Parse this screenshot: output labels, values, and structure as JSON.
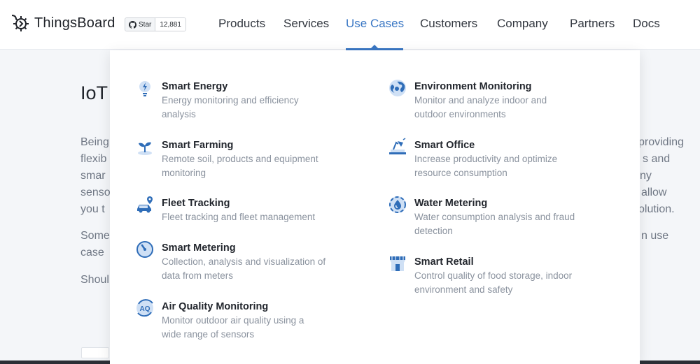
{
  "brand": {
    "name": "ThingsBoard"
  },
  "github": {
    "star_label": "Star",
    "count": "12,881"
  },
  "nav": [
    {
      "label": "Products",
      "name": "nav-products",
      "active": false
    },
    {
      "label": "Services",
      "name": "nav-services",
      "active": false
    },
    {
      "label": "Use Cases",
      "name": "nav-use-cases",
      "active": true
    },
    {
      "label": "Customers",
      "name": "nav-customers",
      "active": false
    },
    {
      "label": "Company",
      "name": "nav-company",
      "active": false
    },
    {
      "label": "Partners",
      "name": "nav-partners",
      "active": false
    },
    {
      "label": "Docs",
      "name": "nav-docs",
      "active": false
    }
  ],
  "background": {
    "title": "IoT",
    "left_lines": [
      "Being",
      "flexib",
      "smar",
      "senso",
      "you t",
      "Some",
      "case",
      "Shoul"
    ],
    "right_lines": [
      "providing",
      "s and",
      "ny",
      "allow",
      "olution.",
      "n use"
    ]
  },
  "menu": {
    "left": [
      {
        "title": "Smart Energy",
        "desc": [
          "Energy monitoring and efficiency",
          "analysis"
        ],
        "icon": "smart-energy-icon"
      },
      {
        "title": "Smart Farming",
        "desc": [
          "Remote soil, products and equipment",
          "monitoring"
        ],
        "icon": "smart-farming-icon"
      },
      {
        "title": "Fleet Tracking",
        "desc": [
          "Fleet tracking and fleet management"
        ],
        "icon": "fleet-tracking-icon"
      },
      {
        "title": "Smart Metering",
        "desc": [
          "Collection, analysis and visualization of",
          "data from meters"
        ],
        "icon": "smart-metering-icon"
      },
      {
        "title": "Air Quality Monitoring",
        "desc": [
          "Monitor outdoor air quality using a",
          "wide range of sensors"
        ],
        "icon": "air-quality-icon"
      }
    ],
    "right": [
      {
        "title": "Environment Monitoring",
        "desc": [
          "Monitor and analyze indoor and",
          "outdoor environments"
        ],
        "icon": "environment-monitoring-icon"
      },
      {
        "title": "Smart Office",
        "desc": [
          "Increase productivity and optimize",
          "resource consumption"
        ],
        "icon": "smart-office-icon"
      },
      {
        "title": "Water Metering",
        "desc": [
          "Water consumption analysis and fraud",
          "detection"
        ],
        "icon": "water-metering-icon"
      },
      {
        "title": "Smart Retail",
        "desc": [
          "Control quality of food storage, indoor",
          "environment and safety"
        ],
        "icon": "smart-retail-icon"
      }
    ],
    "air_quality_badge": "AQ"
  },
  "colors": {
    "accent": "#3a77c4",
    "icon_light": "#cfe0f5",
    "icon_dark": "#2f6db8"
  }
}
